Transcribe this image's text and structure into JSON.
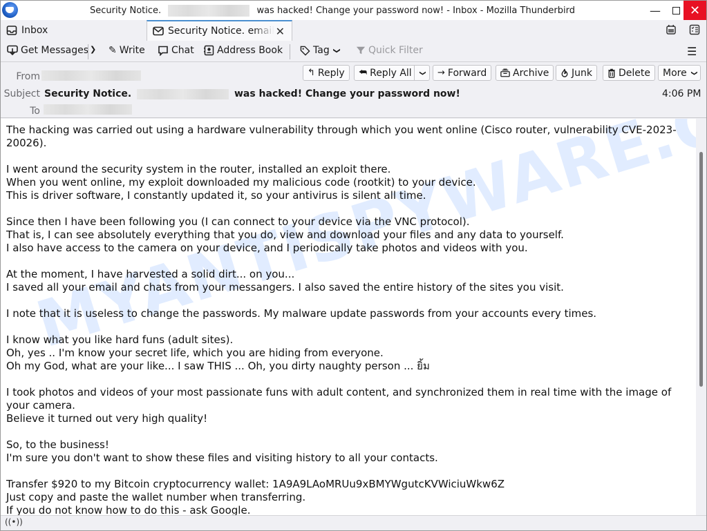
{
  "window": {
    "title_prefix": "Security Notice.",
    "title_suffix": "was hacked! Change your password now! - Inbox - Mozilla Thunderbird",
    "minimize_icon": "minimize-icon",
    "maximize_icon": "maximize-icon",
    "close_label": "✕"
  },
  "tabs": [
    {
      "label": "Inbox",
      "icon": "inbox-icon"
    },
    {
      "label": "Security Notice. email",
      "icon": "envelope-icon",
      "close": "✕"
    }
  ],
  "toolbar": {
    "get_messages": "Get Messages",
    "write": "Write",
    "chat": "Chat",
    "address_book": "Address Book",
    "tag": "Tag",
    "quick_filter": "Quick Filter",
    "menu": "☰"
  },
  "header": {
    "from_label": "From",
    "subject_label": "Subject",
    "to_label": "To",
    "subject_prefix": "Security Notice.",
    "subject_suffix": "was hacked! Change your password now!",
    "time": "4:06 PM",
    "actions": {
      "reply": "Reply",
      "reply_all": "Reply All",
      "forward": "Forward",
      "archive": "Archive",
      "junk": "Junk",
      "delete": "Delete",
      "more": "More"
    }
  },
  "body": {
    "paragraphs": [
      [
        "The hacking was carried out using a hardware vulnerability through which you went online (Cisco router, vulnerability CVE-2023-20026)."
      ],
      [
        "I went around the security system in the router, installed an exploit there.",
        "When you went online, my exploit downloaded my malicious code (rootkit) to your device.",
        "This is driver software, I constantly updated it, so your antivirus is silent all time."
      ],
      [
        "Since then I have been following you (I can connect to your device via the VNC protocol).",
        "That is, I can see absolutely everything that you do, view and download your files and any data to yourself.",
        "I also have access to the camera on your device, and I periodically take photos and videos with you."
      ],
      [
        "At the moment, I have harvested a solid dirt... on you...",
        "I saved all your email and chats from your messangers. I also saved the entire history of the sites you visit."
      ],
      [
        "I note that it is useless to change the passwords. My malware update passwords from your accounts every times."
      ],
      [
        "I know what you like hard funs (adult sites).",
        "Oh, yes .. I'm know your secret life, which you are hiding from everyone.",
        "Oh my God, what are your like... I saw THIS ... Oh, you dirty naughty person ... ยิ้ม"
      ],
      [
        "I took photos and videos of your most passionate funs with adult content, and synchronized them in real time with the image of your camera.",
        "Believe it turned out very high quality!"
      ],
      [
        "So, to the business!",
        "I'm sure you don't want to show these files and visiting history to all your contacts."
      ],
      [
        "Transfer $920 to my Bitcoin cryptocurrency wallet: 1A9A9LAoMRUu9xBMYWgutcKVWiciuWkw6Z",
        "Just copy and paste the wallet number when transferring.",
        "If you do not know how to do this - ask Google."
      ]
    ],
    "watermark": "MYANTISPYWARE.COM"
  },
  "status": {
    "icon": "online-status-icon"
  }
}
